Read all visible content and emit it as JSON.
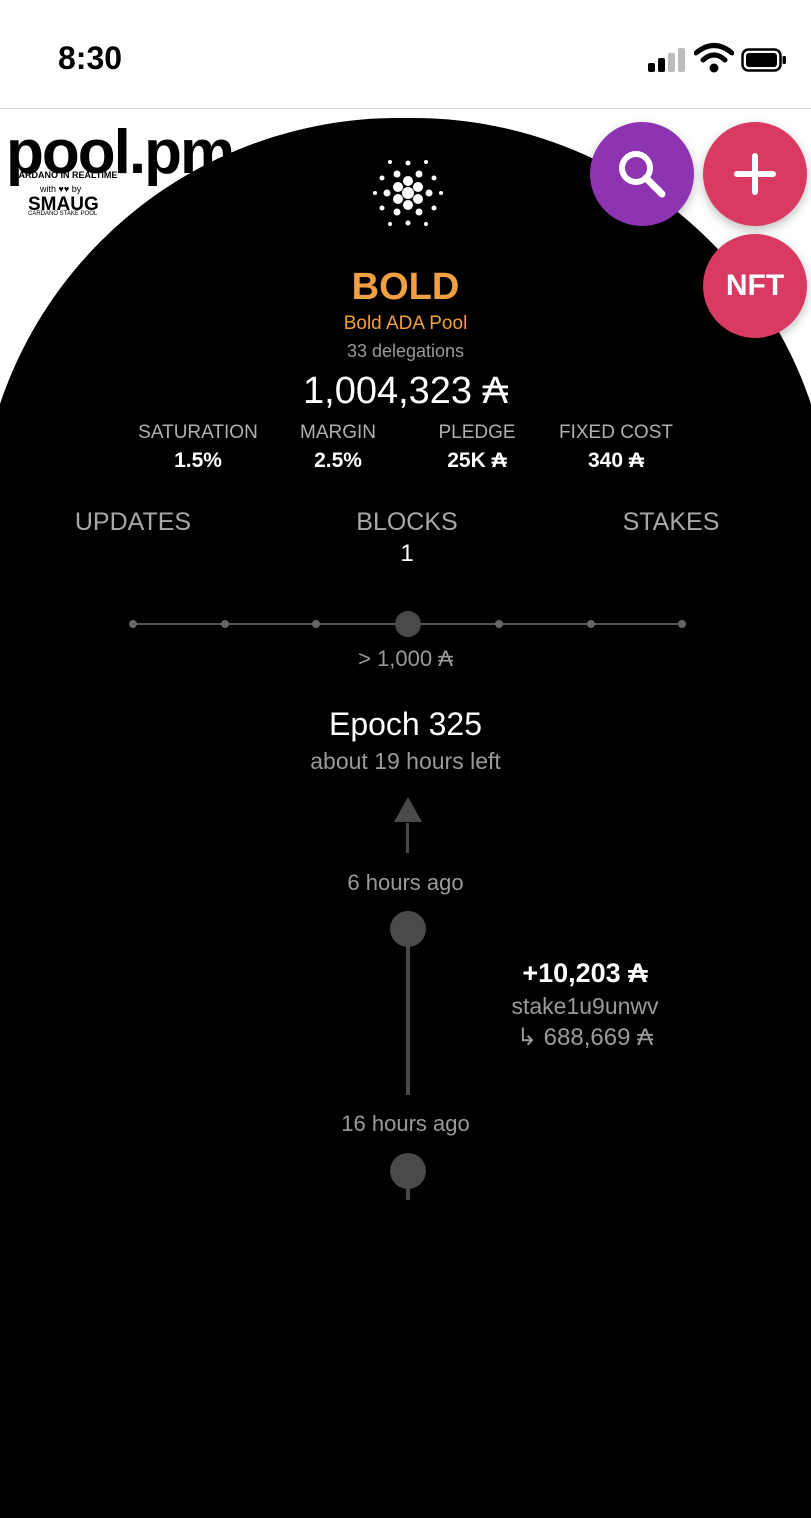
{
  "status_bar": {
    "time": "8:30"
  },
  "logo": {
    "wordmark": "pool.pm",
    "tagline": "CARDANO IN REALTIME",
    "with_by": "with ♥♥ by",
    "partner": "SMAUG",
    "partner_sub": "CARDANO STAKE POOL"
  },
  "actions": {
    "nft_label": "NFT"
  },
  "pool": {
    "ticker": "BOLD",
    "name": "Bold ADA Pool",
    "delegations": "33 delegations",
    "total_stake": "1,004,323 ₳"
  },
  "stats": [
    {
      "label": "SATURATION",
      "value": "1.5%"
    },
    {
      "label": "MARGIN",
      "value": "2.5%"
    },
    {
      "label": "PLEDGE",
      "value": "25K ₳"
    },
    {
      "label": "FIXED COST",
      "value": "340 ₳"
    }
  ],
  "tabs": [
    {
      "label": "UPDATES",
      "count": ""
    },
    {
      "label": "BLOCKS",
      "count": "1"
    },
    {
      "label": "STAKES",
      "count": ""
    }
  ],
  "filter": {
    "value": "> 1,000 ₳"
  },
  "epoch": {
    "title": "Epoch 325",
    "remaining": "about 19 hours left"
  },
  "timeline": [
    {
      "time": "6 hours ago",
      "event": {
        "amount": "+10,203 ₳",
        "address": "stake1u9unwv",
        "balance": "↳ 688,669 ₳"
      }
    },
    {
      "time": "16 hours ago"
    }
  ],
  "colors": {
    "accent_orange": "#f0a042",
    "search_purple": "#8e33b2",
    "action_pink": "#d93a62",
    "background": "#000000"
  }
}
